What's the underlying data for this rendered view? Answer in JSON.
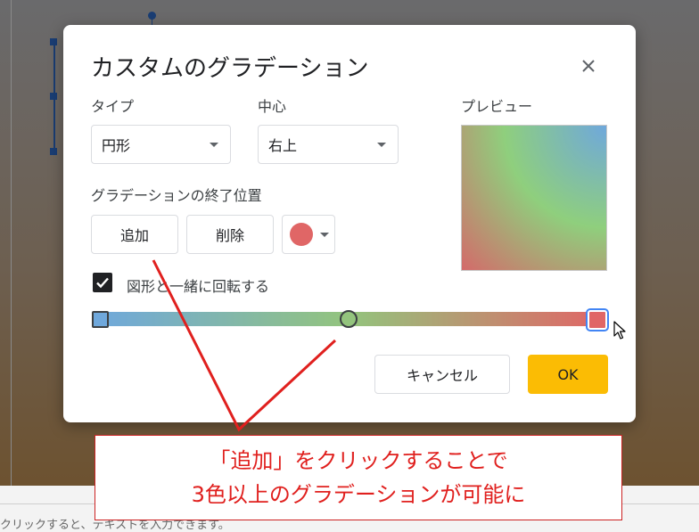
{
  "dialog": {
    "title": "カスタムのグラデーション",
    "type_label": "タイプ",
    "type_value": "円形",
    "center_label": "中心",
    "center_value": "右上",
    "preview_label": "プレビュー",
    "stops_label": "グラデーションの終了位置",
    "add_label": "追加",
    "delete_label": "削除",
    "stop_color": "#e06666",
    "rotate_label": "図形と一緒に回転する",
    "rotate_checked": true,
    "cancel_label": "キャンセル",
    "ok_label": "OK",
    "gradient_colors": [
      "#6fa8dc",
      "#93c47d",
      "#e06666"
    ]
  },
  "annotation": {
    "line1": "「追加」をクリックすることで",
    "line2": "3色以上のグラデーションが可能に",
    "color": "#e0201e"
  },
  "background": {
    "bottom_text": "クリックすると、テキストを入力できます。"
  }
}
